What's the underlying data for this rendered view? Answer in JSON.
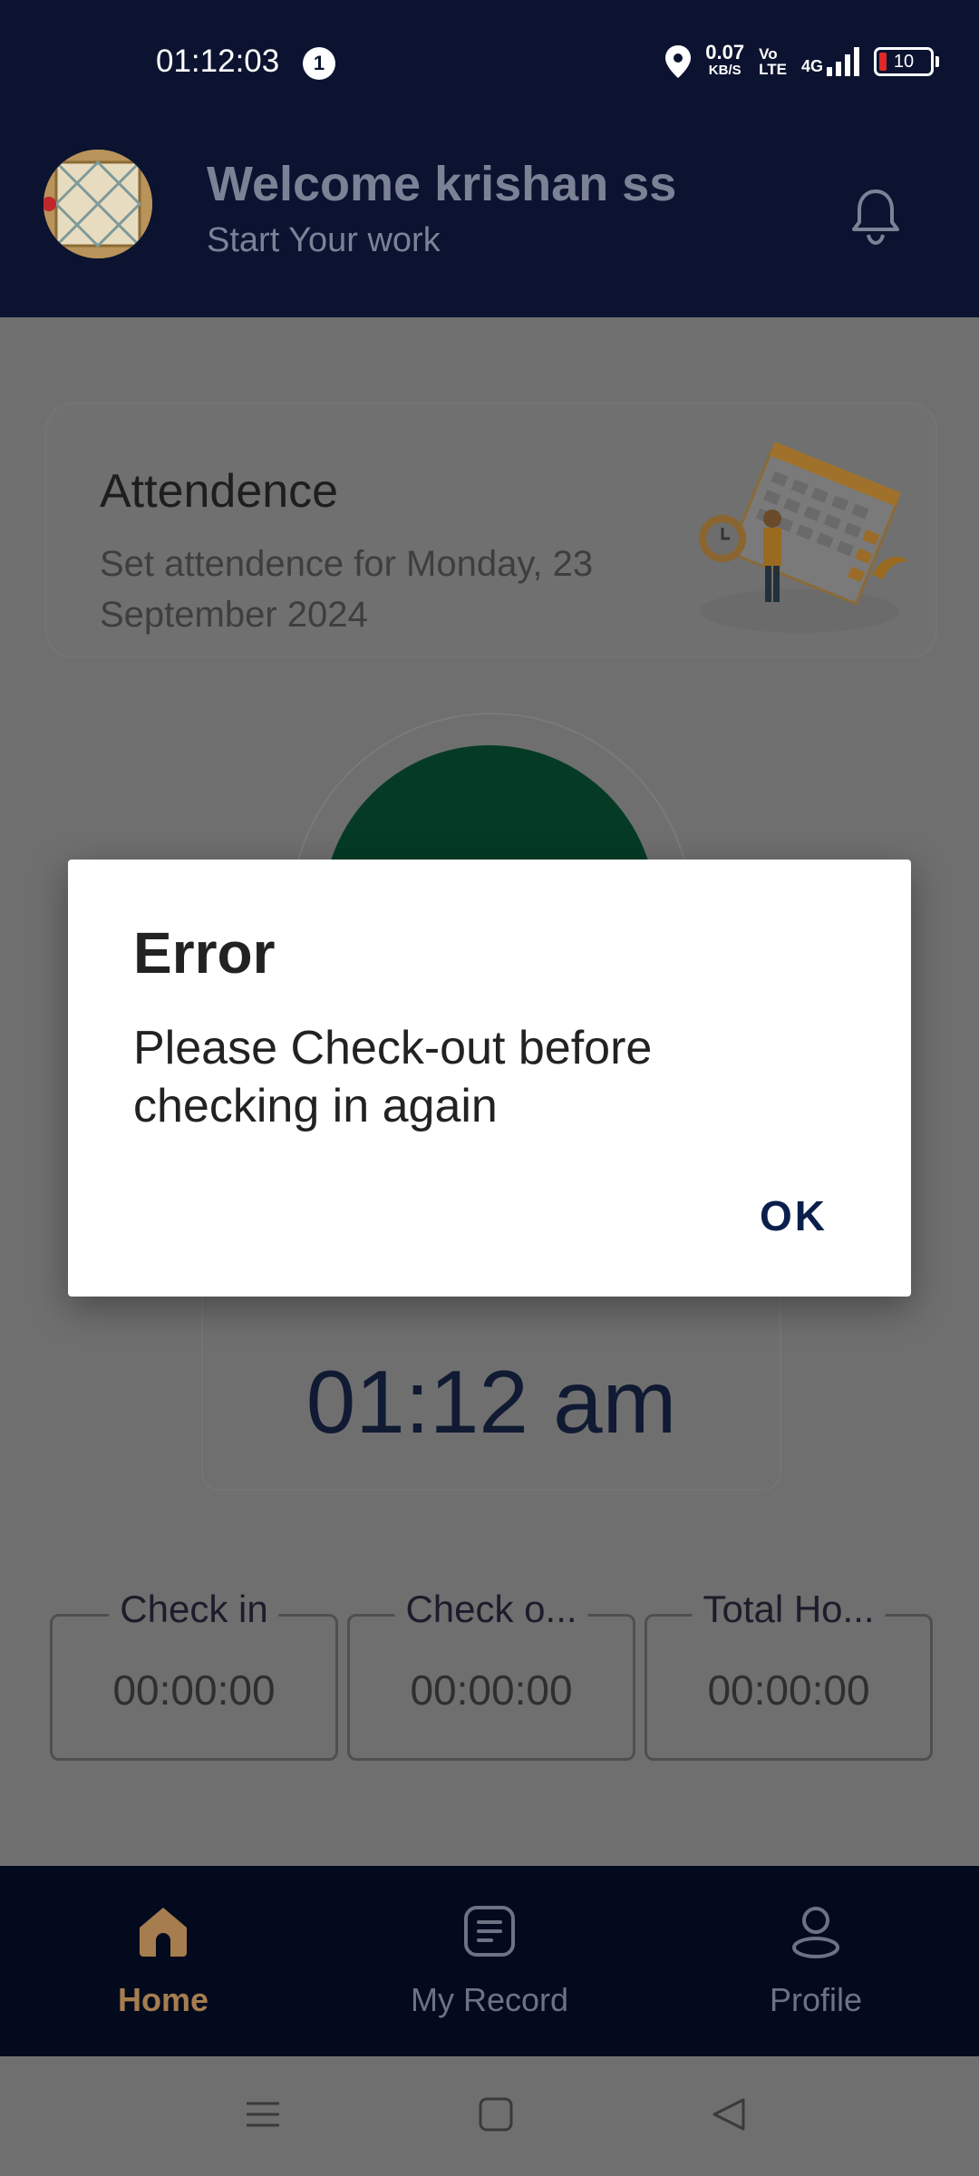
{
  "status_bar": {
    "time": "01:12:03",
    "notification_count": "1",
    "speed_value": "0.07",
    "speed_unit": "KB/S",
    "volte_top": "Vo",
    "volte_bottom": "LTE",
    "network": "4G",
    "battery": "10"
  },
  "header": {
    "welcome": "Welcome krishan ss",
    "subtitle": "Start Your work",
    "bell_icon": "bell-icon"
  },
  "attendance_card": {
    "title": "Attendence",
    "subtitle": "Set attendence for Monday, 23 September 2024"
  },
  "clock": {
    "time": "01:12 am"
  },
  "stats": [
    {
      "label": "Check in",
      "value": "00:00:00"
    },
    {
      "label": "Check o...",
      "value": "00:00:00"
    },
    {
      "label": "Total Ho...",
      "value": "00:00:00"
    }
  ],
  "bottom_nav": [
    {
      "label": "Home",
      "icon": "home-icon",
      "active": true
    },
    {
      "label": "My Record",
      "icon": "record-icon",
      "active": false
    },
    {
      "label": "Profile",
      "icon": "profile-icon",
      "active": false
    }
  ],
  "dialog": {
    "title": "Error",
    "message": "Please Check-out before checking in again",
    "ok_label": "OK"
  },
  "colors": {
    "header_bg": "#0b1330",
    "nav_bg": "#040a1d",
    "accent": "#a57d4f",
    "button_green": "#053b25",
    "overlay": "#6f6f6f"
  }
}
